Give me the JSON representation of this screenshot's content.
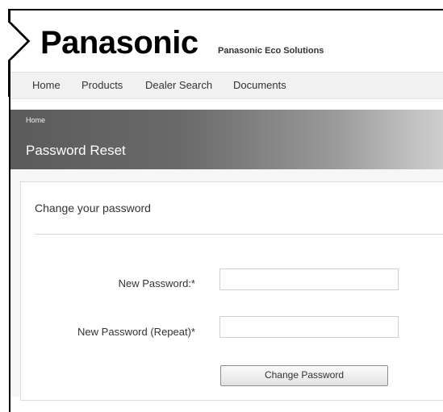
{
  "brand": {
    "logo_text": "Panasonic",
    "tagline": "Panasonic Eco Solutions"
  },
  "nav": {
    "items": [
      {
        "label": "Home"
      },
      {
        "label": "Products"
      },
      {
        "label": "Dealer Search"
      },
      {
        "label": "Documents"
      }
    ]
  },
  "banner": {
    "breadcrumb": "Home",
    "title": "Password Reset"
  },
  "form": {
    "heading": "Change your password",
    "new_password_label": "New Password:*",
    "new_password_value": "",
    "repeat_password_label": "New Password (Repeat)*",
    "repeat_password_value": "",
    "submit_label": "Change Password"
  },
  "colors": {
    "banner_start": "#5b5b5b",
    "banner_end": "#cfcfcf",
    "nav_bg": "#f1f1f1"
  }
}
